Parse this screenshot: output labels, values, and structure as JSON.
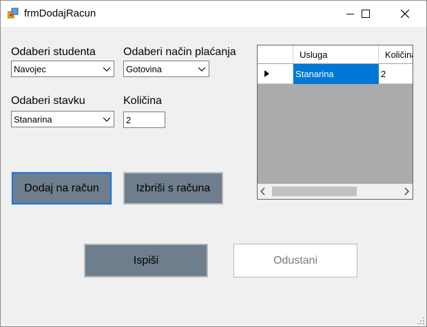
{
  "window": {
    "title": "frmDodajRacun",
    "icon": "form-app-icon",
    "controls": [
      "minimize-icon",
      "maximize-icon",
      "close-icon"
    ]
  },
  "form": {
    "student_label": "Odaberi studenta",
    "student_value": "Navojec",
    "payment_label": "Odaberi način plaćanja",
    "payment_value": "Gotovina",
    "item_label": "Odaberi stavku",
    "item_value": "Stanarina",
    "quantity_label": "Količina",
    "quantity_value": "2"
  },
  "grid": {
    "columns": [
      "Usluga",
      "Količina"
    ],
    "rows": [
      {
        "usluga": "Stanarina",
        "kolicina": "2",
        "selected": true
      }
    ]
  },
  "buttons": {
    "add": "Dodaj na račun",
    "remove": "Izbriši s računa",
    "print": "Ispiši",
    "cancel": "Odustani"
  },
  "colors": {
    "accent": "#0078d7",
    "button_dark": "#6e7e8c",
    "grid_background": "#ababab"
  }
}
